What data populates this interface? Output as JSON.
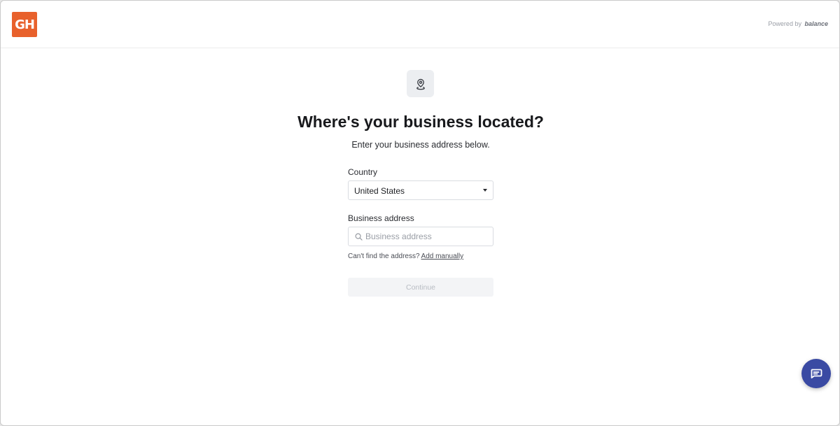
{
  "header": {
    "logo_text": "GH",
    "powered_by": "Powered by",
    "powered_brand": "balance",
    "logo_color": "#e8612c"
  },
  "main": {
    "icon": "location-pin-icon",
    "title": "Where's your business located?",
    "subtitle": "Enter your business address below."
  },
  "form": {
    "country": {
      "label": "Country",
      "selected": "United States"
    },
    "address": {
      "label": "Business address",
      "placeholder": "Business address",
      "value": ""
    },
    "helper_text": "Can't find the address?",
    "add_manually": "Add manually",
    "continue_label": "Continue"
  },
  "chat_widget": {
    "icon": "chat-icon",
    "color": "#3a4aa3"
  }
}
